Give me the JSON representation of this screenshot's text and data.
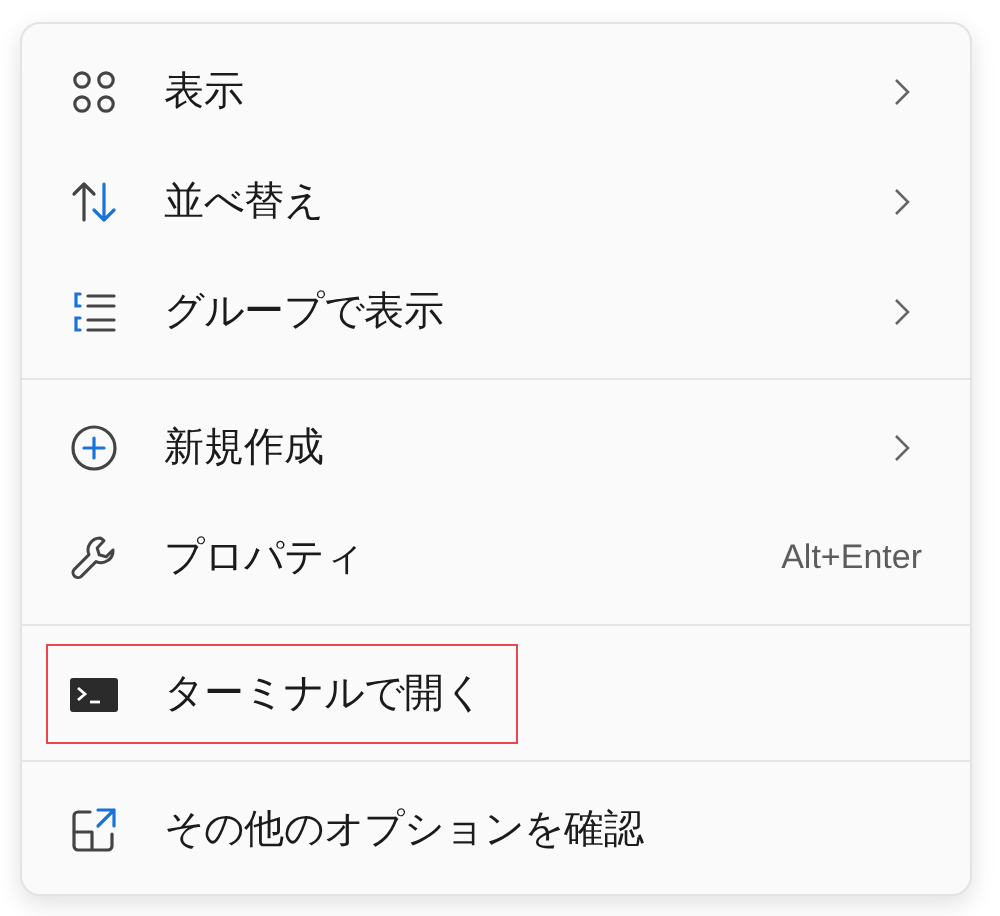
{
  "menu": {
    "groups": [
      {
        "items": [
          {
            "label": "表示",
            "submenu": true,
            "highlighted": false
          },
          {
            "label": "並べ替え",
            "submenu": true,
            "highlighted": false
          },
          {
            "label": "グループで表示",
            "submenu": true,
            "highlighted": false
          }
        ]
      },
      {
        "items": [
          {
            "label": "新規作成",
            "submenu": true,
            "highlighted": false
          },
          {
            "label": "プロパティ",
            "shortcut": "Alt+Enter",
            "submenu": false,
            "highlighted": false
          }
        ]
      },
      {
        "items": [
          {
            "label": "ターミナルで開く",
            "submenu": false,
            "highlighted": true
          }
        ]
      },
      {
        "items": [
          {
            "label": "その他のオプションを確認",
            "submenu": false,
            "highlighted": false
          }
        ]
      }
    ]
  }
}
